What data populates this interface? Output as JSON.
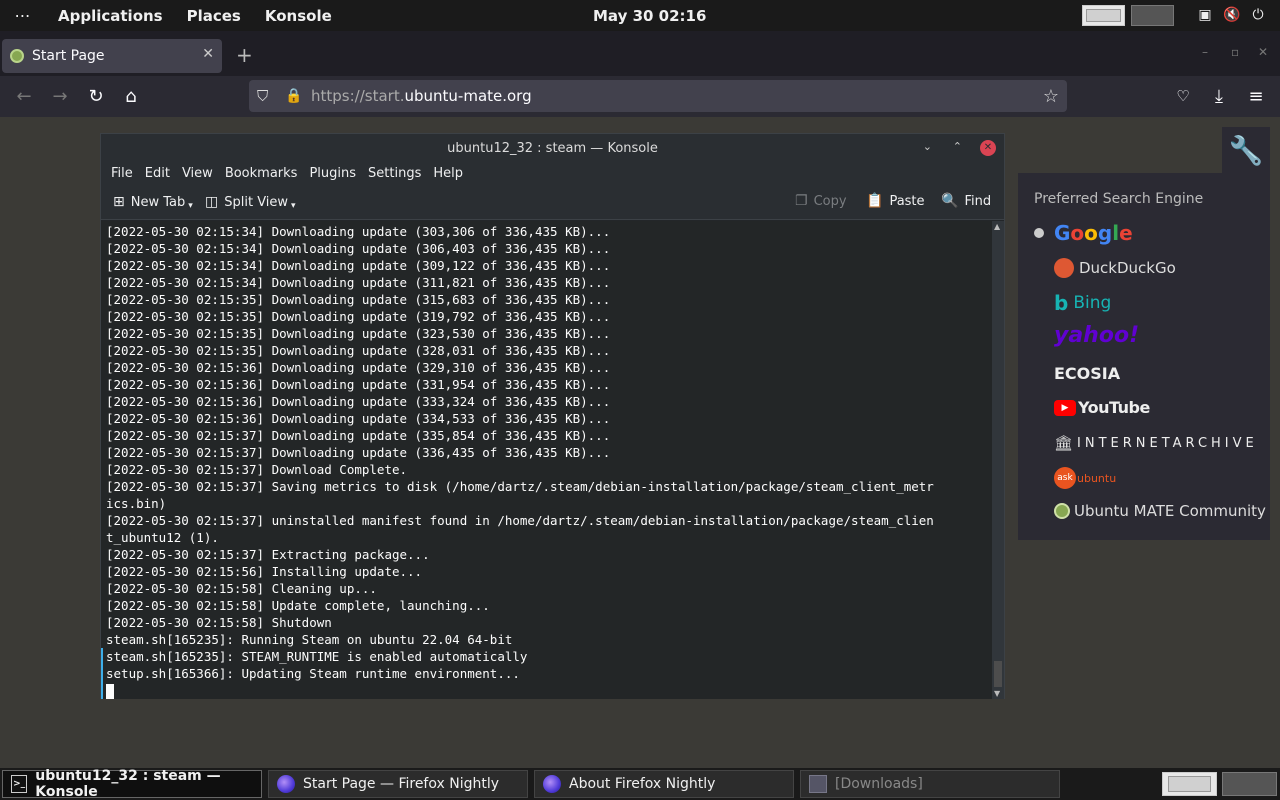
{
  "top_panel": {
    "applications": "Applications",
    "places": "Places",
    "konsole": "Konsole",
    "clock": "May 30  02:16"
  },
  "browser": {
    "tab_title": "Start Page",
    "url_prefix": "https://start.",
    "url_domain": "ubuntu-mate.org"
  },
  "konsole": {
    "title": "ubuntu12_32 : steam — Konsole",
    "menu": [
      "File",
      "Edit",
      "View",
      "Bookmarks",
      "Plugins",
      "Settings",
      "Help"
    ],
    "toolbar": {
      "new_tab": "New Tab",
      "split_view": "Split View",
      "copy": "Copy",
      "paste": "Paste",
      "find": "Find"
    },
    "lines": [
      "[2022-05-30 02:15:34] Downloading update (303,306 of 336,435 KB)...",
      "[2022-05-30 02:15:34] Downloading update (306,403 of 336,435 KB)...",
      "[2022-05-30 02:15:34] Downloading update (309,122 of 336,435 KB)...",
      "[2022-05-30 02:15:34] Downloading update (311,821 of 336,435 KB)...",
      "[2022-05-30 02:15:35] Downloading update (315,683 of 336,435 KB)...",
      "[2022-05-30 02:15:35] Downloading update (319,792 of 336,435 KB)...",
      "[2022-05-30 02:15:35] Downloading update (323,530 of 336,435 KB)...",
      "[2022-05-30 02:15:35] Downloading update (328,031 of 336,435 KB)...",
      "[2022-05-30 02:15:36] Downloading update (329,310 of 336,435 KB)...",
      "[2022-05-30 02:15:36] Downloading update (331,954 of 336,435 KB)...",
      "[2022-05-30 02:15:36] Downloading update (333,324 of 336,435 KB)...",
      "[2022-05-30 02:15:36] Downloading update (334,533 of 336,435 KB)...",
      "[2022-05-30 02:15:37] Downloading update (335,854 of 336,435 KB)...",
      "[2022-05-30 02:15:37] Downloading update (336,435 of 336,435 KB)...",
      "[2022-05-30 02:15:37] Download Complete.",
      "[2022-05-30 02:15:37] Saving metrics to disk (/home/dartz/.steam/debian-installation/package/steam_client_metr",
      "ics.bin)",
      "[2022-05-30 02:15:37] uninstalled manifest found in /home/dartz/.steam/debian-installation/package/steam_clien",
      "t_ubuntu12 (1).",
      "[2022-05-30 02:15:37] Extracting package...",
      "[2022-05-30 02:15:56] Installing update...",
      "[2022-05-30 02:15:58] Cleaning up...",
      "[2022-05-30 02:15:58] Update complete, launching...",
      "[2022-05-30 02:15:58] Shutdown",
      "steam.sh[165235]: Running Steam on ubuntu 22.04 64-bit",
      "steam.sh[165235]: STEAM_RUNTIME is enabled automatically",
      "setup.sh[165366]: Updating Steam runtime environment..."
    ]
  },
  "search_panel": {
    "heading": "Preferred Search Engine",
    "google": "Google",
    "duckduckgo": "DuckDuckGo",
    "bing": "Bing",
    "yahoo": "yahoo!",
    "ecosia": "ECOSIA",
    "youtube": "YouTube",
    "internet_archive": "INTERNETARCHIVE",
    "askubuntu": "ubuntu",
    "ubuntu_mate": "Ubuntu MATE Community"
  },
  "taskbar": [
    {
      "label": "ubuntu12_32 : steam — Konsole"
    },
    {
      "label": "Start Page — Firefox Nightly"
    },
    {
      "label": "About Firefox Nightly"
    },
    {
      "label": "[Downloads]"
    }
  ]
}
